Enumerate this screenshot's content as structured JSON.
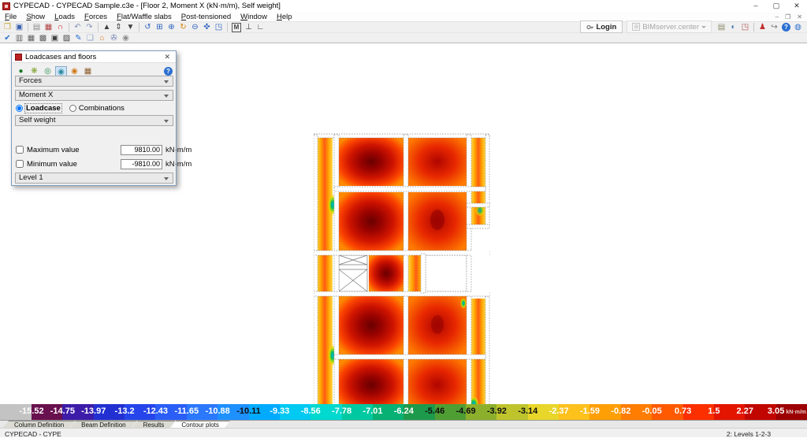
{
  "window": {
    "title": "CYPECAD - CYPECAD Sample.c3e - [Floor 2, Moment X (kN·m/m), Self weight]",
    "minimize": "–",
    "maximize": "▢",
    "close": "✕"
  },
  "mdi": {
    "minimize": "–",
    "restore": "❐",
    "close": "✕"
  },
  "menu": {
    "items": [
      "File",
      "Show",
      "Loads",
      "Forces",
      "Flat/Waffle slabs",
      "Post-tensioned",
      "Window",
      "Help"
    ]
  },
  "toolbar_main": [
    {
      "n": "open-file",
      "g": "❒",
      "c": "#c9a227"
    },
    {
      "n": "save-file",
      "g": "▣",
      "c": "#3a62b0"
    },
    {
      "sep": true
    },
    {
      "n": "job-list",
      "g": "▤",
      "c": "#8a8a8a"
    },
    {
      "n": "job-manager",
      "g": "▦",
      "c": "#b04040"
    },
    {
      "n": "magnet-snap",
      "g": "∩",
      "c": "#d02020"
    },
    {
      "sep": true
    },
    {
      "n": "undo",
      "g": "↶",
      "c": "#8090b8"
    },
    {
      "n": "redo",
      "g": "↷",
      "c": "#8090b8"
    },
    {
      "sep": true
    },
    {
      "n": "floor-up",
      "g": "▲",
      "c": "#404040"
    },
    {
      "n": "floor-select",
      "g": "⇕",
      "c": "#404040"
    },
    {
      "n": "floor-down",
      "g": "▼",
      "c": "#404040"
    },
    {
      "sep": true
    },
    {
      "n": "rotate-view",
      "g": "↺",
      "c": "#2a5fc0"
    },
    {
      "n": "zoom-window",
      "g": "⊞",
      "c": "#2a5fc0"
    },
    {
      "n": "zoom-in",
      "g": "⊕",
      "c": "#2a5fc0"
    },
    {
      "n": "redraw",
      "g": "↻",
      "c": "#d4820a"
    },
    {
      "n": "zoom-out",
      "g": "⊖",
      "c": "#2a5fc0"
    },
    {
      "n": "pan-view",
      "g": "✜",
      "c": "#2a5fc0"
    },
    {
      "n": "previous-view",
      "g": "◳",
      "c": "#2a5fc0"
    },
    {
      "sep": true
    },
    {
      "n": "texts-plan",
      "g": "M",
      "c": "#404040",
      "boxed": true
    },
    {
      "n": "elevation-view",
      "g": "⊥",
      "c": "#404040"
    },
    {
      "n": "measure",
      "g": "∟",
      "c": "#404040"
    }
  ],
  "toolbar_secondary": [
    {
      "n": "verify-check",
      "g": "✔",
      "c": "#2a6fd0"
    },
    {
      "n": "columns-tool",
      "g": "▥",
      "c": "#606060"
    },
    {
      "n": "beams-tool",
      "g": "▦",
      "c": "#606060"
    },
    {
      "n": "crossed-beams-tool",
      "g": "▩",
      "c": "#606060"
    },
    {
      "n": "slabs-tool",
      "g": "▣",
      "c": "#404040"
    },
    {
      "n": "waffle-tool",
      "g": "▨",
      "c": "#404040"
    },
    {
      "n": "edit-surface",
      "g": "✎",
      "c": "#2a6fd0"
    },
    {
      "n": "annotation-bubble",
      "g": "❑",
      "c": "#8aa0c8"
    },
    {
      "n": "protect-job",
      "g": "⌂",
      "c": "#e07818"
    },
    {
      "n": "attachment",
      "g": "✇",
      "c": "#6a7ab0"
    },
    {
      "n": "visibility",
      "g": "◉",
      "c": "#909090"
    }
  ],
  "account": {
    "login": "Login",
    "bim": "BIMserver.center",
    "icons": [
      {
        "n": "print",
        "g": "▤",
        "c": "#8a8a6a"
      },
      {
        "n": "export-web",
        "g": "◐",
        "c": "#4a7ab0"
      },
      {
        "n": "share-project",
        "g": "◳",
        "c": "#b05050"
      },
      {
        "sep": true
      },
      {
        "n": "users",
        "g": "♟",
        "c": "#c03030"
      },
      {
        "n": "exit-application",
        "g": "↪",
        "c": "#707070"
      },
      {
        "n": "help",
        "g": "?",
        "c": "#ffffff",
        "bg": "#2a6fd0",
        "round": true
      },
      {
        "n": "cype-web",
        "g": "◍",
        "c": "#2a6fd0"
      }
    ]
  },
  "dialog": {
    "title": "Loadcases and floors",
    "close": "✕",
    "help": "?",
    "icons": [
      {
        "n": "displacements-option",
        "g": "●",
        "c": "#1a7a2a"
      },
      {
        "n": "forces-option",
        "g": "❋",
        "c": "#7aa02a"
      },
      {
        "n": "isolines-option",
        "g": "◎",
        "c": "#2a8a4a"
      },
      {
        "n": "contour-plot-option",
        "g": "◉",
        "c": "#2a8aa0",
        "active": true
      },
      {
        "n": "deformed-option",
        "g": "◉",
        "c": "#d07818"
      },
      {
        "n": "quantities-option",
        "g": "▦",
        "c": "#8a5a2a"
      }
    ],
    "selects": {
      "category": "Forces",
      "force": "Moment X",
      "loadcase": "Self weight",
      "level": "Level 1"
    },
    "radio": {
      "loadcase": "Loadcase",
      "combinations": "Combinations"
    },
    "max_label": "Maximum value",
    "max_value": "9810.00",
    "min_label": "Minimum value",
    "min_value": "-9810.00",
    "unit": "kN·m/m"
  },
  "scale": {
    "unit": "kN·m/m",
    "values": [
      "-15.52",
      "-14.75",
      "-13.97",
      "-13.2",
      "-12.43",
      "-11.65",
      "-10.88",
      "-10.11",
      "-9.33",
      "-8.56",
      "-7.78",
      "-7.01",
      "-6.24",
      "-5.46",
      "-4.69",
      "-3.92",
      "-3.14",
      "-2.37",
      "-1.59",
      "-0.82",
      "-0.05",
      "0.73",
      "1.5",
      "2.27",
      "3.05"
    ],
    "colors": [
      "#69104e",
      "#3c1ca8",
      "#2230d2",
      "#2545ea",
      "#2a5ef6",
      "#2b78fc",
      "#1e90ff",
      "#00abff",
      "#00c9f2",
      "#00d9cf",
      "#00c9a1",
      "#06b173",
      "#1d9a4b",
      "#4f9e34",
      "#8db02c",
      "#bfc42c",
      "#e8d62a",
      "#fdc11c",
      "#ff9f06",
      "#ff7d00",
      "#ff5a00",
      "#fb2f00",
      "#e31500",
      "#c10600",
      "#9c0000"
    ],
    "dark_text": [
      7,
      13,
      14,
      15,
      16
    ]
  },
  "tabs": {
    "items": [
      "Column Definition",
      "Beam Definition",
      "Results",
      "Contour plots"
    ],
    "active": "Contour plots"
  },
  "status": {
    "app": "CYPECAD - CYPE",
    "levels": "2: Levels 1-2-3"
  }
}
